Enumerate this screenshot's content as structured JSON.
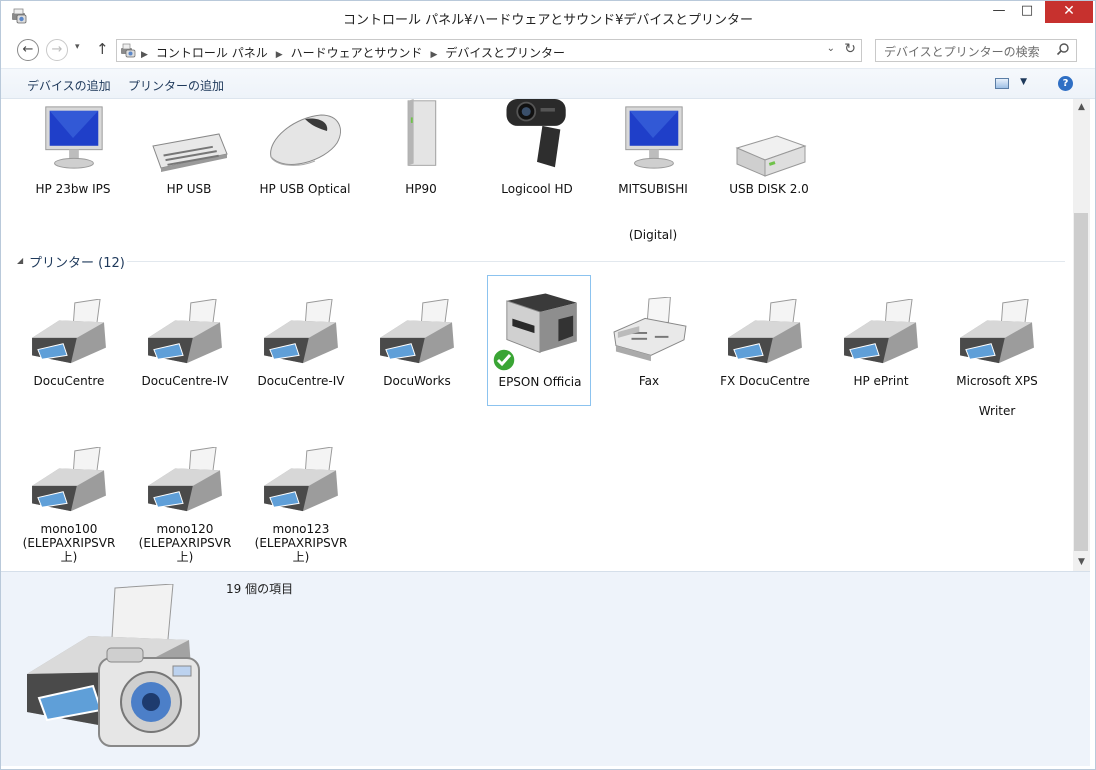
{
  "window": {
    "title": "コントロール パネル¥ハードウェアとサウンド¥デバイスとプリンター",
    "minimize": "—",
    "maximize": "□",
    "close": "✕"
  },
  "address": {
    "back": "←",
    "forward": "→",
    "recent": "▾",
    "up": "↑",
    "breadcrumbs": [
      "コントロール パネル",
      "ハードウェアとサウンド",
      "デバイスとプリンター"
    ],
    "separator": "▶",
    "dropdown": "⌄",
    "refresh": "↻",
    "search_placeholder": "デバイスとプリンターの検索"
  },
  "toolbar": {
    "add_device": "デバイスの追加",
    "add_printer": "プリンターの追加",
    "view_drop": "▼",
    "help": "?"
  },
  "devices": [
    {
      "label": "HP 23bw IPS",
      "icon": "monitor-icon"
    },
    {
      "label": "HP USB",
      "icon": "keyboard-icon"
    },
    {
      "label": "HP USB Optical",
      "icon": "mouse-icon"
    },
    {
      "label": "HP90",
      "icon": "computer-tower-icon"
    },
    {
      "label": "Logicool HD",
      "icon": "webcam-icon"
    },
    {
      "label": "MITSUBISHI",
      "extra": "(Digital)",
      "icon": "monitor-icon"
    },
    {
      "label": "USB DISK 2.0",
      "icon": "usb-disk-icon"
    }
  ],
  "printers_group": {
    "title": "プリンター (12)",
    "arrow": "◢"
  },
  "printers": [
    {
      "label": "DocuCentre",
      "icon": "printer-icon"
    },
    {
      "label": "DocuCentre-IV",
      "icon": "printer-icon"
    },
    {
      "label": "DocuCentre-IV",
      "icon": "printer-icon"
    },
    {
      "label": "DocuWorks",
      "icon": "printer-icon"
    },
    {
      "label": "EPSON Officia",
      "icon": "multifunction-printer-icon",
      "selected": true,
      "default": true
    },
    {
      "label": "Fax",
      "icon": "fax-icon"
    },
    {
      "label": "FX DocuCentre",
      "icon": "printer-icon"
    },
    {
      "label": "HP ePrint",
      "icon": "printer-icon"
    },
    {
      "label": "Microsoft XPS",
      "extra": "Writer",
      "icon": "printer-icon"
    },
    {
      "label": "mono100",
      "extra": "(ELEPAXRIPSVR",
      "extra2": "上)",
      "icon": "printer-icon"
    },
    {
      "label": "mono120",
      "extra": "(ELEPAXRIPSVR",
      "extra2": "上)",
      "icon": "printer-icon"
    },
    {
      "label": "mono123",
      "extra": "(ELEPAXRIPSVR",
      "extra2": "上)",
      "icon": "printer-icon"
    }
  ],
  "details": {
    "count": "19 個の項目",
    "icon": "devices-and-printers-icon"
  },
  "scroll": {
    "up": "▲",
    "down": "▼"
  },
  "colors": {
    "accent": "#1e395b",
    "close": "#c7312e",
    "details_bg": "#eef3fa",
    "selection": "#8cc3ef"
  }
}
